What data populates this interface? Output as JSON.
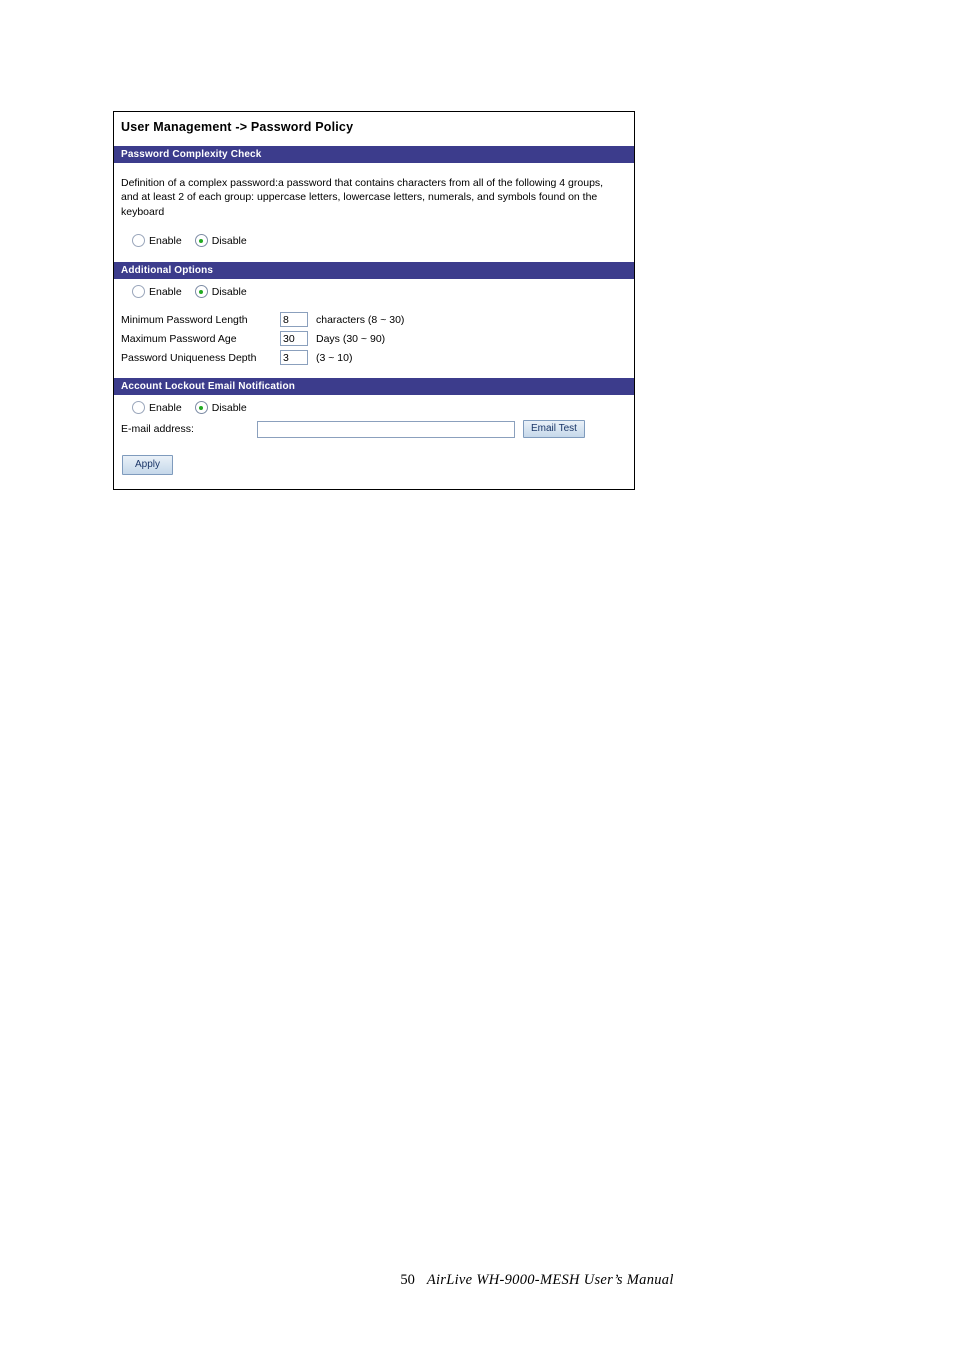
{
  "panel": {
    "title": "User Management -> Password Policy",
    "sections": {
      "complexity": {
        "header": "Password Complexity Check",
        "description": "Definition of a complex password:a password that contains characters from all of the following 4 groups, and at least 2 of each group: uppercase letters, lowercase letters, numerals, and symbols found on the keyboard",
        "enable_label": "Enable",
        "disable_label": "Disable",
        "selected": "Disable"
      },
      "additional": {
        "header": "Additional Options",
        "enable_label": "Enable",
        "disable_label": "Disable",
        "selected": "Disable",
        "fields": [
          {
            "label": "Minimum Password Length",
            "value": "8",
            "hint": "characters (8 ~ 30)"
          },
          {
            "label": "Maximum Password Age",
            "value": "30",
            "hint": "Days  (30 ~ 90)"
          },
          {
            "label": "Password Uniqueness Depth",
            "value": "3",
            "hint": "(3 ~ 10)"
          }
        ]
      },
      "lockout": {
        "header": "Account Lockout Email Notification",
        "enable_label": "Enable",
        "disable_label": "Disable",
        "selected": "Disable",
        "email_label": "E-mail address:",
        "email_value": "",
        "email_placeholder": "",
        "email_test_label": "Email Test"
      }
    },
    "apply_label": "Apply"
  },
  "footer": {
    "page_number": "50",
    "manual_title": "AirLive  WH-9000-MESH  User’s  Manual"
  },
  "colors": {
    "section_header_bg": "#3c3c8c",
    "section_header_text": "#ffffff",
    "radio_selected_dot": "#22aa22",
    "button_text": "#1b3668",
    "panel_border": "#000000"
  }
}
